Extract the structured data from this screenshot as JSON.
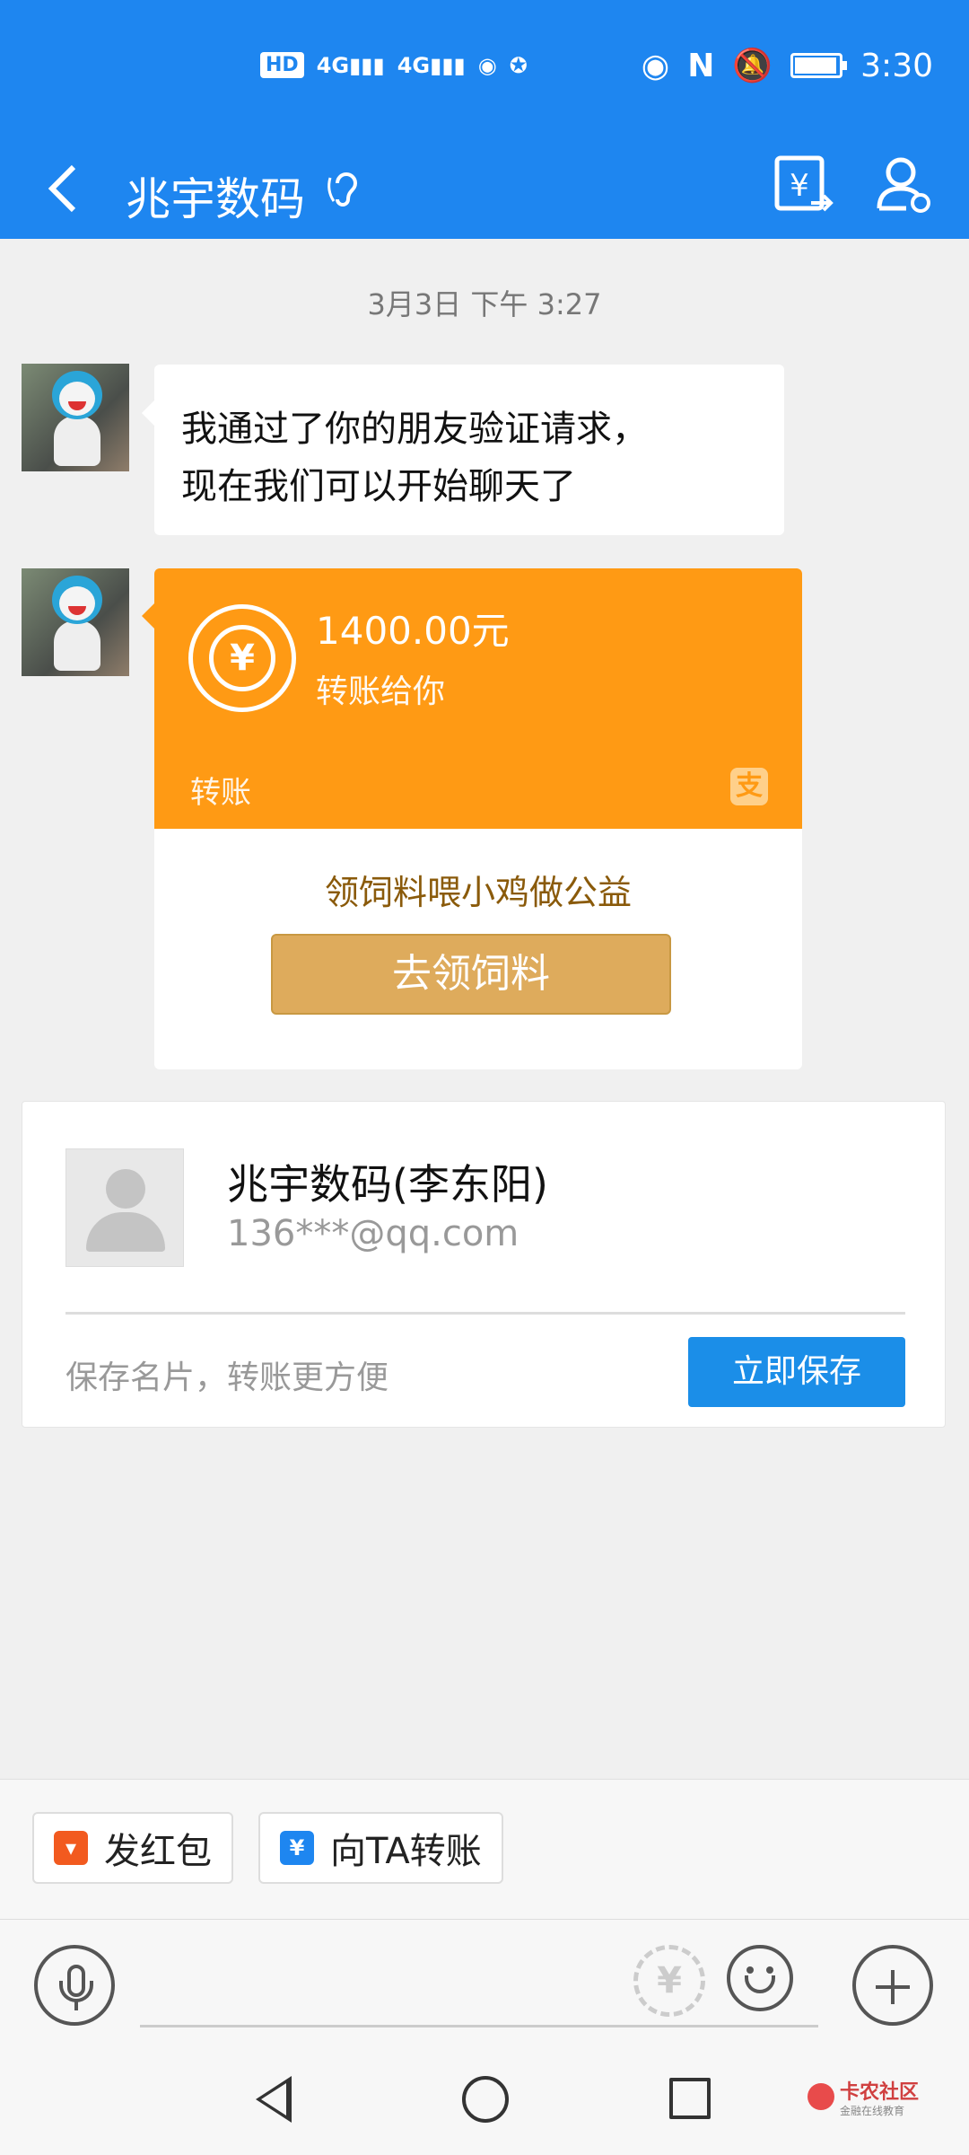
{
  "status_bar": {
    "left_icons": [
      "HD",
      "4G",
      "4G"
    ],
    "time": "3:30"
  },
  "navbar": {
    "title": "兆宇数码",
    "icons": [
      "back-icon",
      "ear-icon",
      "transfer-yen-icon",
      "contact-icon"
    ]
  },
  "chat": {
    "timestamp": "3月3日 下午 3:27",
    "message1": {
      "line1": "我通过了你的朋友验证请求，",
      "line2": "现在我们可以开始聊天了"
    },
    "transfer": {
      "amount": "1400.00元",
      "description": "转账给你",
      "label": "转账",
      "promo": "领饲料喂小鸡做公益",
      "button": "去领饲料",
      "color": "#ff9a14"
    }
  },
  "card": {
    "name": "兆宇数码(李东阳)",
    "account": "136***@qq.com",
    "hint": "保存名片，转账更方便",
    "save_button": "立即保存",
    "button_color": "#1b8ee8"
  },
  "quick_actions": [
    {
      "label": "发红包",
      "icon": "red-packet-icon",
      "color": "#f25a1f"
    },
    {
      "label": "向TA转账",
      "icon": "transfer-icon",
      "color": "#1e86f0"
    }
  ],
  "input": {
    "placeholder": "",
    "icons": [
      "mic-icon",
      "yen-icon",
      "emoji-icon",
      "plus-icon"
    ]
  },
  "watermark": {
    "title": "卡农社区",
    "subtitle": "金融在线教育"
  },
  "theme": {
    "header": "#1e86f0",
    "background": "#f0f0f0"
  }
}
